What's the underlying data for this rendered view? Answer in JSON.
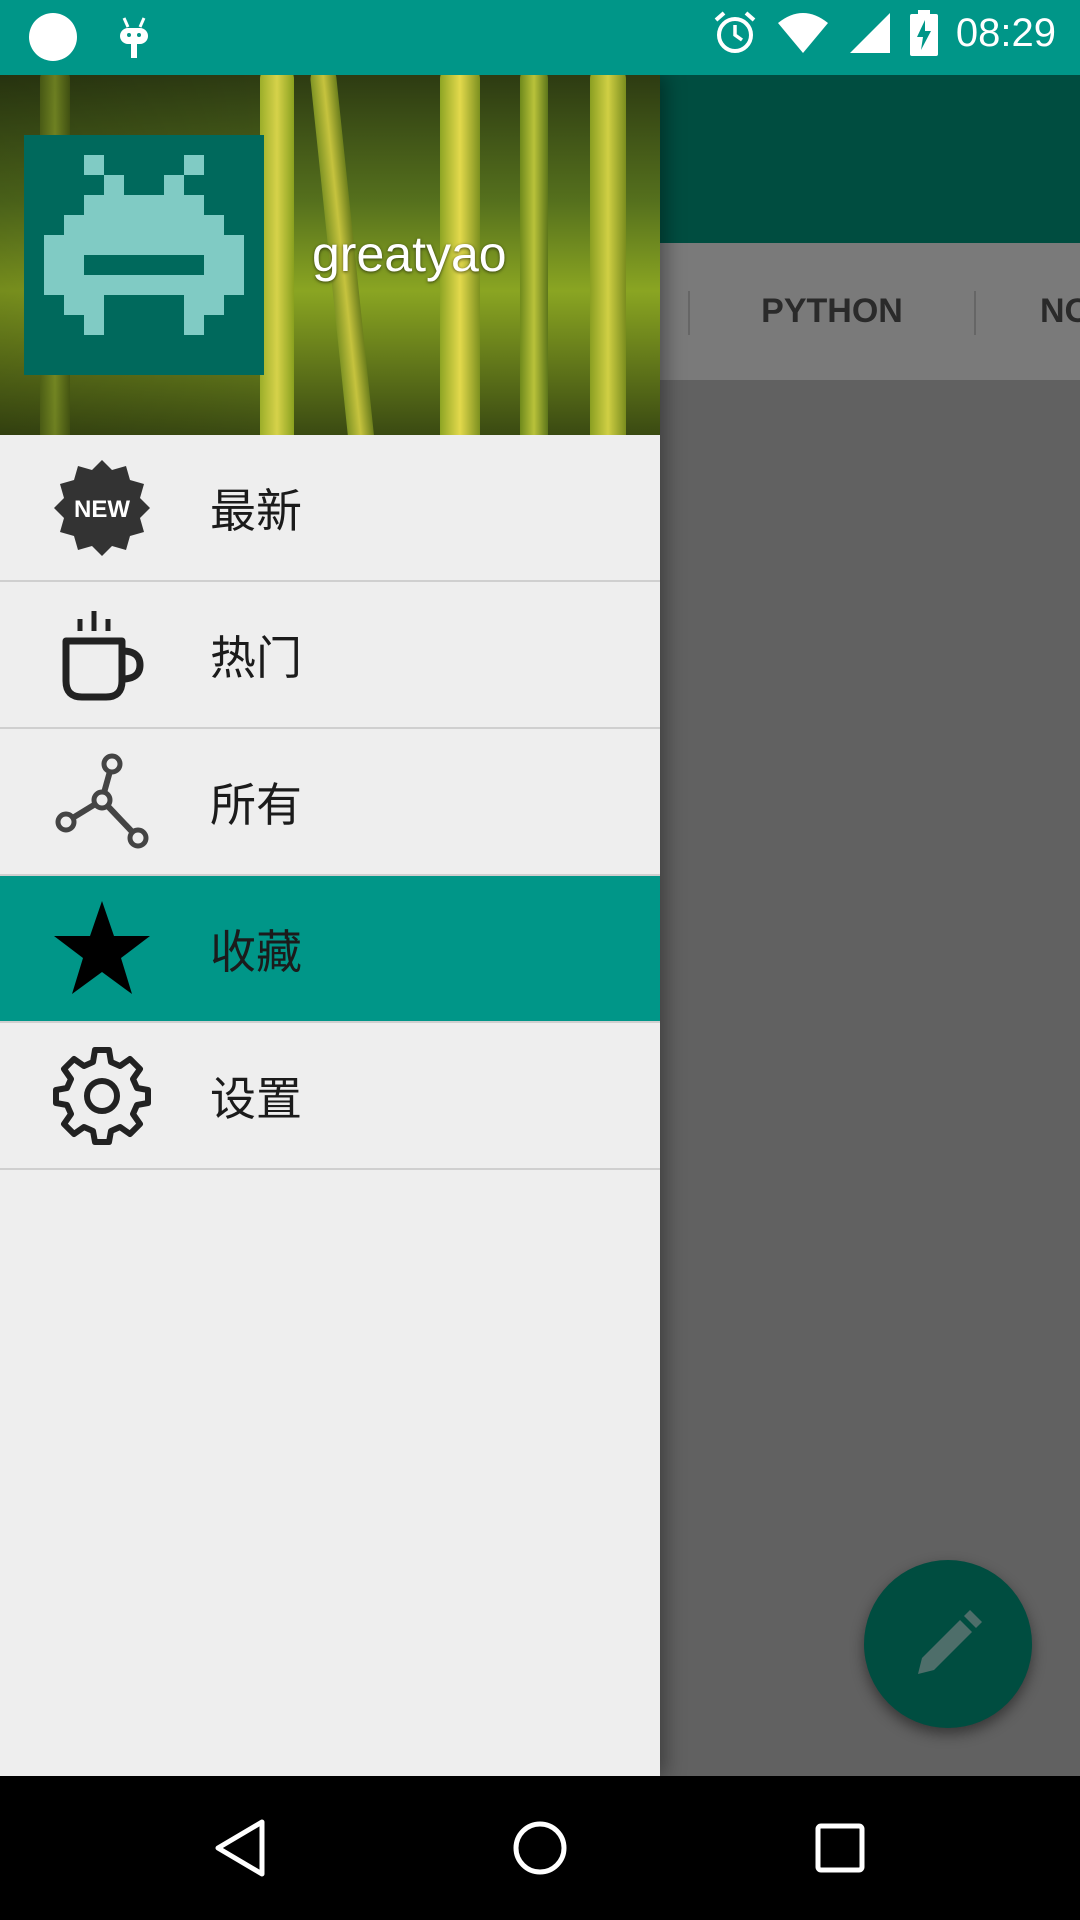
{
  "status_bar": {
    "time": "08:29",
    "icons": [
      "circle-icon",
      "android-debug-icon",
      "alarm-icon",
      "wifi-icon",
      "signal-icon",
      "battery-charging-icon"
    ]
  },
  "background_app": {
    "tabs": [
      "PYTHON",
      "NO"
    ],
    "fab_icon": "pencil-icon"
  },
  "drawer": {
    "username": "greatyao",
    "items": [
      {
        "label": "最新",
        "icon": "new-badge-icon",
        "selected": false
      },
      {
        "label": "热门",
        "icon": "coffee-cup-icon",
        "selected": false
      },
      {
        "label": "所有",
        "icon": "graph-nodes-icon",
        "selected": false
      },
      {
        "label": "收藏",
        "icon": "star-icon",
        "selected": true
      },
      {
        "label": "设置",
        "icon": "gear-icon",
        "selected": false
      }
    ],
    "accent_color": "#009688",
    "new_badge_text": "NEW"
  },
  "nav_bar": {
    "buttons": [
      "back-icon",
      "home-icon",
      "recents-icon"
    ]
  }
}
